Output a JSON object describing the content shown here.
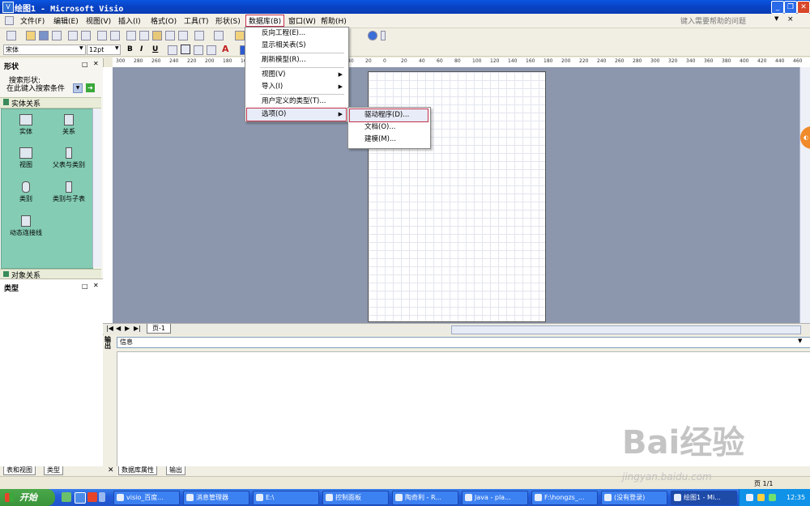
{
  "window": {
    "title": "绘图1 - Microsoft Visio",
    "icon": "visio-app-icon"
  },
  "menubar": {
    "items": [
      "文件(F)",
      "编辑(E)",
      "视图(V)",
      "插入(I)",
      "格式(O)",
      "工具(T)",
      "形状(S)",
      "数据库(B)",
      "窗口(W)",
      "帮助(H)"
    ],
    "active_item": "数据库(B)",
    "help_placeholder": "键入需要帮助的问题"
  },
  "format_toolbar": {
    "font": "宋体",
    "size": "12pt",
    "bold": "B",
    "italic": "I",
    "underline": "U"
  },
  "shapes_panel": {
    "title": "形状",
    "search_label": "搜索形状:",
    "search_placeholder": "在此键入搜索条件",
    "stencil_header": "实体关系",
    "shapes": [
      "实体",
      "关系",
      "视图",
      "父表与类别",
      "类别",
      "类别与子表",
      "动态连接线"
    ],
    "object_header": "对象关系"
  },
  "category_panel": {
    "title": "类型"
  },
  "left_tabs": [
    "表和视图",
    "类型"
  ],
  "ruler": {
    "labels": [
      "300",
      "280",
      "260",
      "240",
      "220",
      "200",
      "180",
      "160",
      "140",
      "120",
      "100",
      "80",
      "60",
      "40",
      "20",
      "0",
      "20",
      "40",
      "60",
      "80",
      "100",
      "120",
      "140",
      "160",
      "180",
      "200",
      "220",
      "240",
      "260",
      "280",
      "300",
      "320",
      "340",
      "360",
      "380",
      "400",
      "420",
      "440",
      "460",
      "480"
    ]
  },
  "page_tab": "页-1",
  "info_window": {
    "dropdown_value": "信息",
    "side_label": "输出"
  },
  "bottom_tabs": [
    "数据库属性",
    "输出"
  ],
  "status": {
    "page_indicator": "页 1/1"
  },
  "database_menu": {
    "items": [
      {
        "label": "反向工程(E)...",
        "arrow": false
      },
      {
        "label": "显示相关表(S)",
        "arrow": false
      },
      {
        "label": "刷新模型(R)...",
        "arrow": false
      },
      {
        "label": "视图(V)",
        "arrow": true
      },
      {
        "label": "导入(I)",
        "arrow": true
      },
      {
        "label": "用户定义的类型(T)...",
        "arrow": false
      },
      {
        "label": "选项(O)",
        "arrow": true
      }
    ],
    "highlighted": "选项(O)"
  },
  "options_submenu": {
    "items": [
      "驱动程序(D)...",
      "文档(O)...",
      "建模(M)..."
    ],
    "highlighted": "驱动程序(D)..."
  },
  "taskbar": {
    "start_label": "开始",
    "tasks": [
      "visio_百度...",
      "消息管理器",
      "E:\\",
      "控制面板",
      "陶奇利 - R...",
      "Java - pla...",
      "F:\\hongzs_...",
      "(没有登录)",
      "绘图1 - Mi..."
    ],
    "active_task": "绘图1 - Mi...",
    "clock": "12:35"
  },
  "watermark": {
    "brand": "Bai经验",
    "url": "jingyan.baidu.com"
  },
  "accent": {
    "selection_border": "#c0304a",
    "stencil_bg": "#84ccb4",
    "canvas_bg": "#8c97ad",
    "taskbar": "#245edb"
  }
}
